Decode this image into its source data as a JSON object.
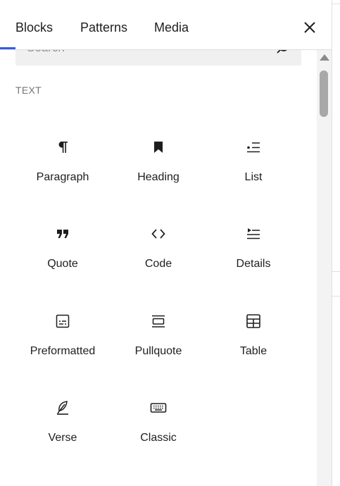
{
  "tabs": [
    {
      "label": "Blocks"
    },
    {
      "label": "Patterns"
    },
    {
      "label": "Media"
    }
  ],
  "search": {
    "placeholder": "Search"
  },
  "category": "TEXT",
  "blocks": [
    {
      "label": "Paragraph",
      "icon": "paragraph-icon"
    },
    {
      "label": "Heading",
      "icon": "bookmark-icon"
    },
    {
      "label": "List",
      "icon": "list-icon"
    },
    {
      "label": "Quote",
      "icon": "quote-icon"
    },
    {
      "label": "Code",
      "icon": "code-icon"
    },
    {
      "label": "Details",
      "icon": "details-icon"
    },
    {
      "label": "Preformatted",
      "icon": "preformatted-icon"
    },
    {
      "label": "Pullquote",
      "icon": "pullquote-icon"
    },
    {
      "label": "Table",
      "icon": "table-icon"
    },
    {
      "label": "Verse",
      "icon": "feather-icon"
    },
    {
      "label": "Classic",
      "icon": "keyboard-icon"
    }
  ],
  "colors": {
    "accent": "#3858e9",
    "text": "#1e1e1e",
    "muted": "#757575"
  }
}
